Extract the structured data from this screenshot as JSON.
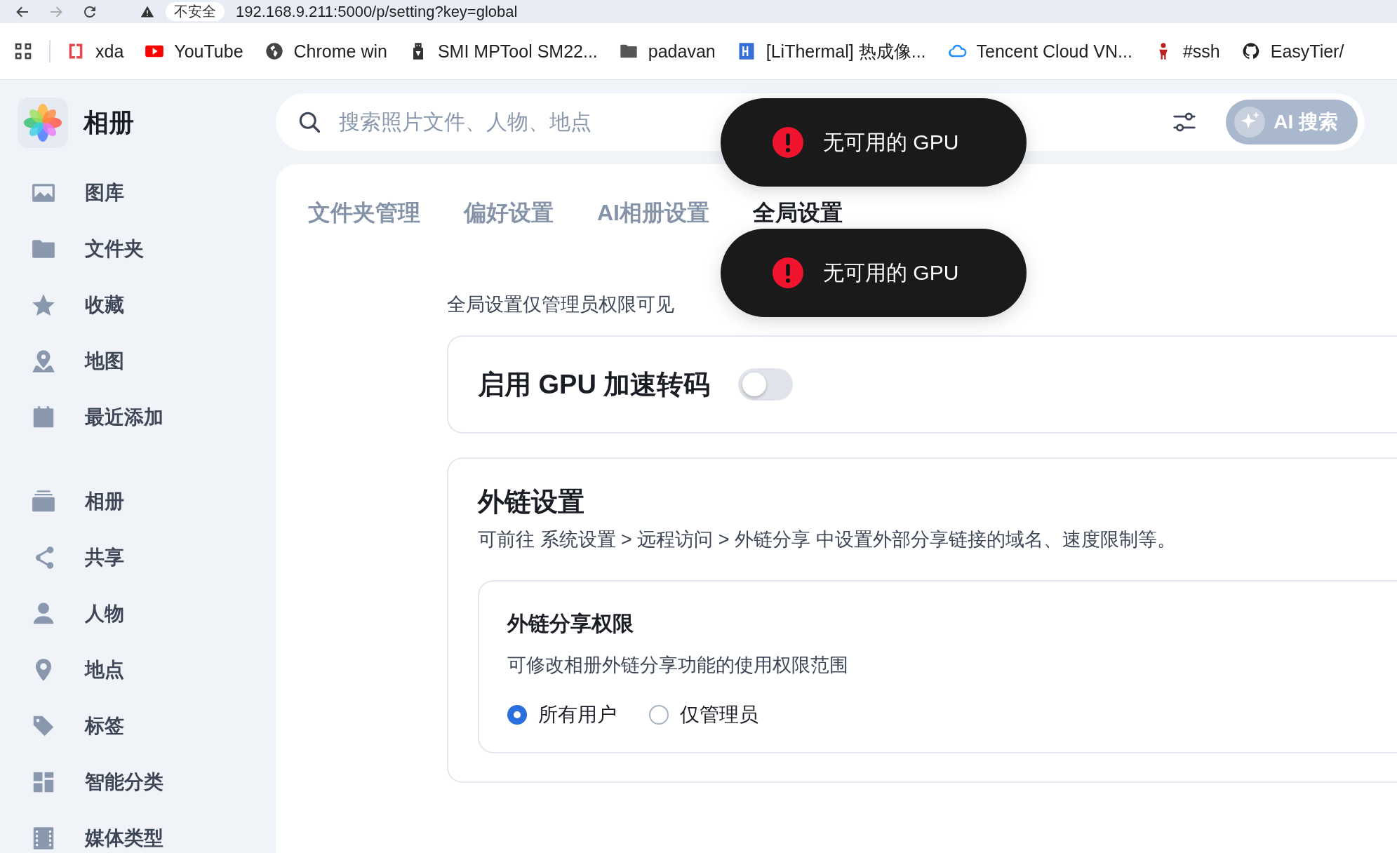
{
  "browser": {
    "security": "不安全",
    "url": "192.168.9.211:5000/p/setting?key=global"
  },
  "bookmarks": [
    "xda",
    "YouTube",
    "Chrome win",
    "SMI MPTool SM22...",
    "padavan",
    "[LiThermal] 热成像...",
    "Tencent Cloud VN...",
    "#ssh",
    "EasyTier/"
  ],
  "sidebar": {
    "title": "相册",
    "groups": [
      [
        "图库",
        "文件夹",
        "收藏",
        "地图",
        "最近添加"
      ],
      [
        "相册",
        "共享",
        "人物",
        "地点",
        "标签",
        "智能分类",
        "媒体类型"
      ]
    ]
  },
  "search": {
    "placeholder": "搜索照片文件、人物、地点",
    "ai_button": "AI 搜索"
  },
  "tabs": [
    {
      "label": "文件夹管理",
      "selected": false
    },
    {
      "label": "偏好设置",
      "selected": false
    },
    {
      "label": "AI相册设置",
      "selected": false
    },
    {
      "label": "全局设置",
      "selected": true
    }
  ],
  "note": "全局设置仅管理员权限可见",
  "gpu_card": {
    "label": "启用 GPU 加速转码",
    "on": false
  },
  "link_card": {
    "title": "外链设置",
    "description": "可前往 系统设置 > 远程访问 > 外链分享 中设置外部分享链接的域名、速度限制等。",
    "permission": {
      "title": "外链分享权限",
      "description": "可修改相册外链分享功能的使用权限范围",
      "options": [
        {
          "label": "所有用户",
          "selected": true
        },
        {
          "label": "仅管理员",
          "selected": false
        }
      ]
    }
  },
  "toasts": [
    {
      "kind": "error",
      "text": "无可用的 GPU"
    },
    {
      "kind": "error",
      "text": "无可用的 GPU"
    }
  ]
}
